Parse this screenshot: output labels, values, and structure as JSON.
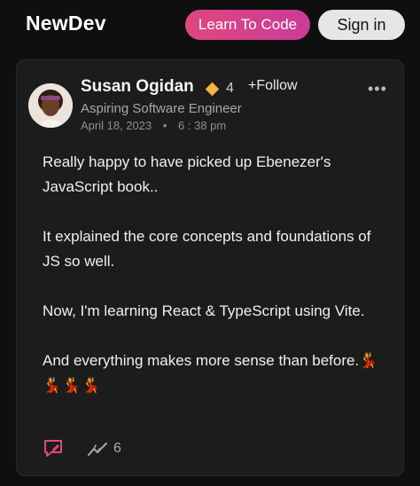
{
  "header": {
    "brand": "NewDev",
    "learn_button": "Learn To Code",
    "signin_button": "Sign in"
  },
  "post": {
    "author": {
      "name": "Susan Ogidan",
      "title": "Aspiring Software Engineer",
      "reputation": "4",
      "follow_label": "+Follow"
    },
    "date": "April 18, 2023",
    "separator": "•",
    "time": "6 : 38 pm",
    "more_label": "•••",
    "paragraphs": [
      "Really happy to have picked up Ebenezer's JavaScript book..",
      "It explained the core concepts and foundations of JS so well.",
      "Now, I'm learning React & TypeScript using Vite.",
      "And everything makes more sense than before."
    ],
    "emojis": "💃💃💃💃",
    "trend_count": "6"
  },
  "colors": {
    "accent_gradient_start": "#e0477d",
    "accent_gradient_end": "#c93c9a",
    "reputation_diamond": "#f4b53f",
    "comment_icon": "#e0477d"
  }
}
